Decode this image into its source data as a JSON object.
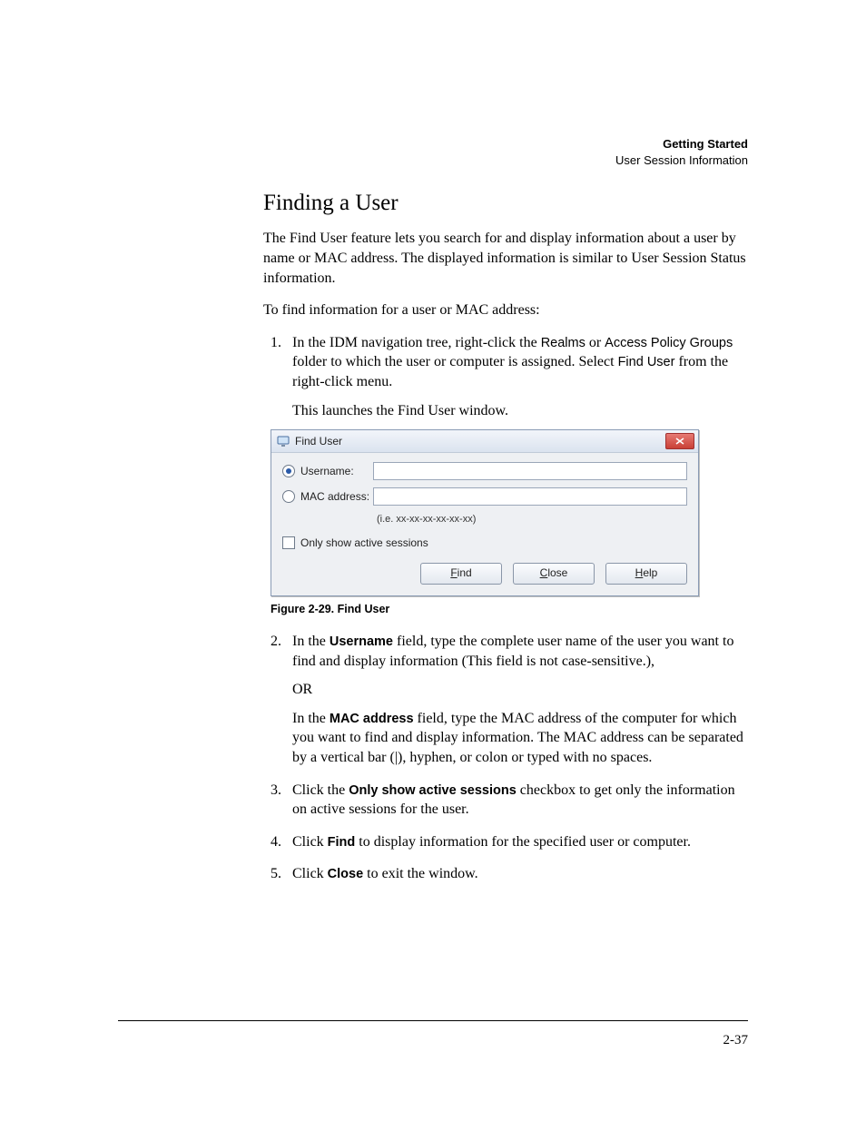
{
  "header": {
    "title": "Getting Started",
    "subtitle": "User Session Information"
  },
  "heading": "Finding a User",
  "intro_paragraph": "The Find User feature lets you search for and display information about a user by name or MAC address. The displayed information is similar to User Session Status information.",
  "lead_in": "To find information for a user or MAC address:",
  "step1": {
    "pre": "In the IDM navigation tree, right-click the ",
    "realms": "Realms",
    "mid1": " or ",
    "apg": "Access Policy Groups",
    "mid2": " folder to which the user or computer is assigned. Select ",
    "find_user": "Find User",
    "post": " from the right-click menu.",
    "launch": "This launches the Find User window."
  },
  "dialog": {
    "title": "Find User",
    "username_label": "Username:",
    "mac_label": "MAC address:",
    "mac_hint": "(i.e. xx-xx-xx-xx-xx-xx)",
    "checkbox_label": "Only show active sessions",
    "buttons": {
      "find_u": "F",
      "find_rest": "ind",
      "close_u": "C",
      "close_rest": "lose",
      "help_u": "H",
      "help_rest": "elp"
    }
  },
  "figure_caption": "Figure 2-29. Find User",
  "step2": {
    "p1_pre": "In the ",
    "p1_bold": "Username",
    "p1_post": " field, type the complete user name of the user you want to find and display information (This field is not case-sensitive.),",
    "or": "OR",
    "p2_pre": "In the ",
    "p2_bold": "MAC address",
    "p2_post": " field, type the MAC address of the computer for which you want to find and display information. The MAC address can be separated by a vertical bar (|), hyphen, or colon or typed with no spaces."
  },
  "step3": {
    "pre": "Click the ",
    "bold": "Only show active sessions",
    "post": " checkbox to get only the information on active sessions for the user."
  },
  "step4": {
    "pre": "Click ",
    "bold": "Find",
    "post": " to display information for the specified user or computer."
  },
  "step5": {
    "pre": "Click ",
    "bold": "Close",
    "post": " to exit the window."
  },
  "page_number": "2-37"
}
